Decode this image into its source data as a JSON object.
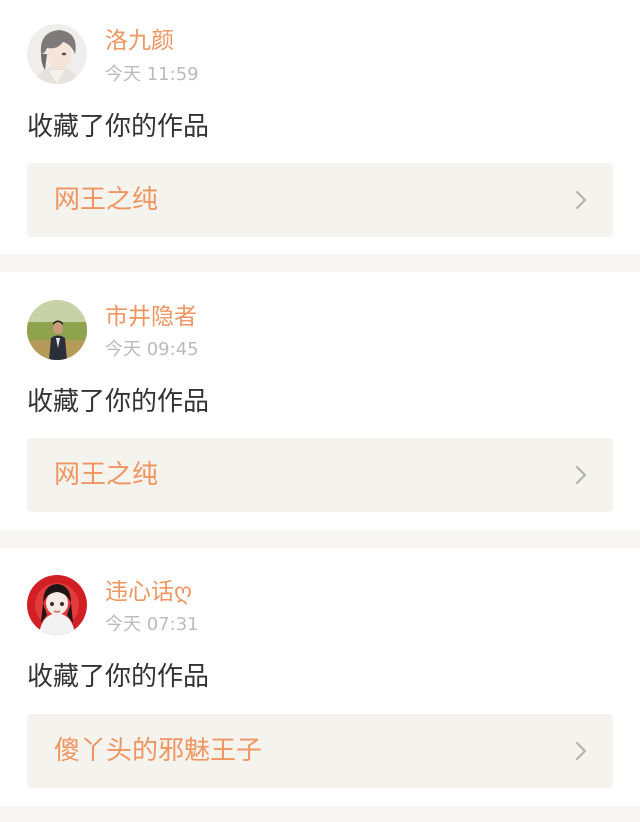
{
  "notifications": [
    {
      "user": "洛九颜",
      "time": "今天 11:59",
      "action": "收藏了你的作品",
      "work_title": "网王之纯",
      "avatar_icon": "anime-boy-avatar-icon"
    },
    {
      "user": "市井隐者",
      "time": "今天 09:45",
      "action": "收藏了你的作品",
      "work_title": "网王之纯",
      "avatar_icon": "man-in-field-avatar-icon"
    },
    {
      "user": "违心话ღ",
      "time": "今天 07:31",
      "action": "收藏了你的作品",
      "work_title": "傻丫头的邪魅王子",
      "avatar_icon": "anime-girl-red-avatar-icon"
    }
  ],
  "colors": {
    "accent": "#ef9560",
    "timestamp": "#bcbcbc",
    "body_text": "#333333",
    "link_background": "#f4f3ee",
    "page_background": "#f7f6f4"
  }
}
